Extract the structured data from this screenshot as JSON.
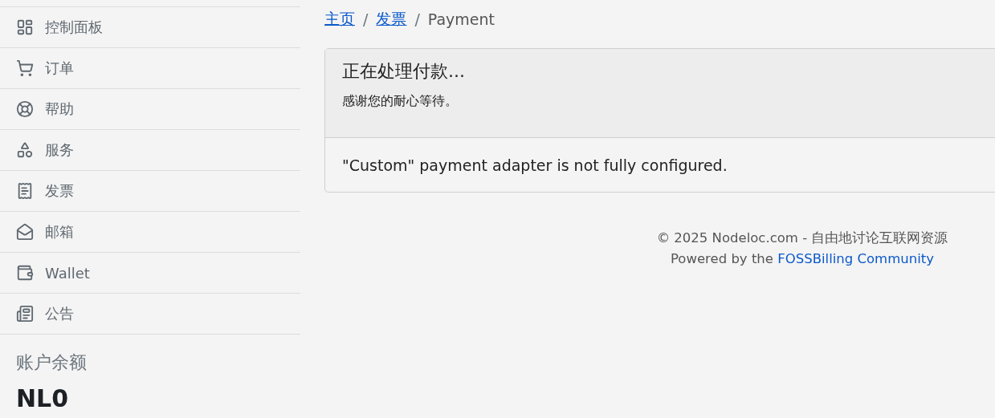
{
  "sidebar": {
    "items": [
      {
        "kind": "dashboard",
        "label": "控制面板"
      },
      {
        "kind": "cart",
        "label": "订单"
      },
      {
        "kind": "help",
        "label": "帮助"
      },
      {
        "kind": "services",
        "label": "服务"
      },
      {
        "kind": "invoice",
        "label": "发票"
      },
      {
        "kind": "mail",
        "label": "邮箱"
      },
      {
        "kind": "wallet",
        "label": "Wallet"
      },
      {
        "kind": "news",
        "label": "公告"
      }
    ],
    "balance": {
      "title": "账户余额",
      "amount": "NL0"
    }
  },
  "breadcrumb_separators": [
    "/",
    "/"
  ],
  "breadcrumb": [
    {
      "label": "主页",
      "kind": "link"
    },
    {
      "label": "发票",
      "kind": "link"
    },
    {
      "label": "Payment",
      "kind": "current"
    }
  ],
  "card": {
    "title": "正在处理付款...",
    "subtitle": "感谢您的耐心等待。",
    "message": "\"Custom\" payment adapter is not fully configured."
  },
  "footer": {
    "copyright": "© 2025 Nodeloc.com - 自由地讨论互联网资源",
    "powered": "Powered by the",
    "link": "FOSSBilling Community"
  }
}
